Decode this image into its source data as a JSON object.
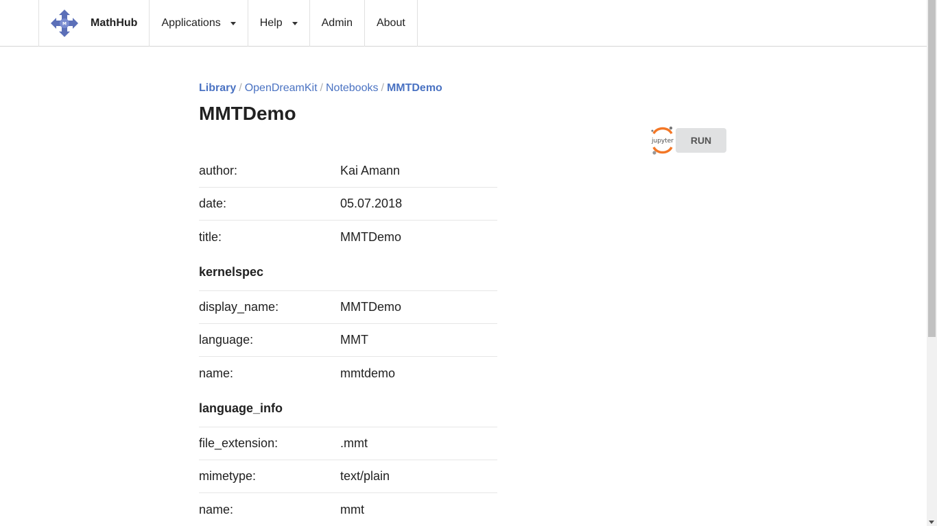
{
  "nav": {
    "brand": "MathHub",
    "items": [
      {
        "label": "Applications"
      },
      {
        "label": "Help"
      },
      {
        "label": "Admin"
      },
      {
        "label": "About"
      }
    ]
  },
  "breadcrumb": {
    "items": [
      "Library",
      "OpenDreamKit",
      "Notebooks"
    ],
    "separator": "/",
    "current": "MMTDemo"
  },
  "page": {
    "title": "MMTDemo",
    "run_label": "RUN",
    "jupyter_logo_text": "jupyter"
  },
  "metadata": {
    "top": [
      {
        "key": "author:",
        "value": "Kai Amann"
      },
      {
        "key": "date:",
        "value": "05.07.2018"
      },
      {
        "key": "title:",
        "value": "MMTDemo"
      }
    ],
    "kernelspec": {
      "heading": "kernelspec",
      "rows": [
        {
          "key": "display_name:",
          "value": "MMTDemo"
        },
        {
          "key": "language:",
          "value": "MMT"
        },
        {
          "key": "name:",
          "value": "mmtdemo"
        }
      ]
    },
    "language_info": {
      "heading": "language_info",
      "rows": [
        {
          "key": "file_extension:",
          "value": ".mmt"
        },
        {
          "key": "mimetype:",
          "value": "text/plain"
        },
        {
          "key": "name:",
          "value": "mmt"
        }
      ]
    }
  },
  "colors": {
    "link": "#4a72c2",
    "logo": "#5b6fb8",
    "jupyter_orange": "#f37726",
    "button_bg": "#e0e1e2"
  }
}
